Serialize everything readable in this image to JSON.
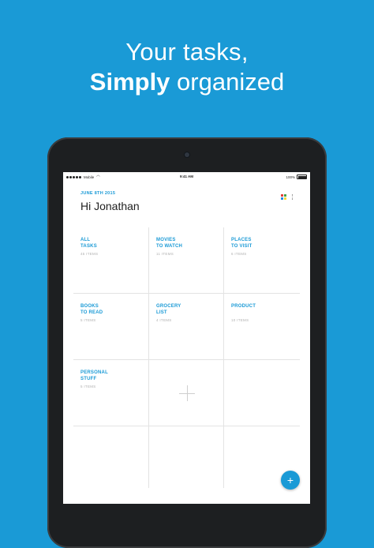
{
  "headline": {
    "line1": "Your tasks,",
    "line2_bold": "Simply",
    "line2_rest": " organized"
  },
  "status_bar": {
    "carrier": "Mobile",
    "time": "9:41 AM",
    "battery": "100%"
  },
  "header": {
    "date": "JUNE 8TH 2015",
    "greeting": "Hi Jonathan"
  },
  "colors": {
    "accent": "#1a9ad6",
    "grid_icon": [
      "#e53935",
      "#43a047",
      "#1e88e5",
      "#fdd835"
    ]
  },
  "icons": {
    "grid": "grid-view-icon",
    "more": "more-vertical-icon",
    "add_list": "plus-icon",
    "fab": "plus-icon"
  },
  "lists": [
    {
      "title": "All\nTasks",
      "count": "45 ITEMS"
    },
    {
      "title": "Movies\nto watch",
      "count": "11 ITEMS"
    },
    {
      "title": "Places\nto visit",
      "count": "6 ITEMS"
    },
    {
      "title": "Books\nto read",
      "count": "5 ITEMS"
    },
    {
      "title": "Grocery\nList",
      "count": "4 ITEMS"
    },
    {
      "title": "Product",
      "count": "10 ITEMS"
    },
    {
      "title": "Personal\nStuff",
      "count": "5 ITEMS"
    }
  ],
  "fab": {
    "label": "+"
  }
}
